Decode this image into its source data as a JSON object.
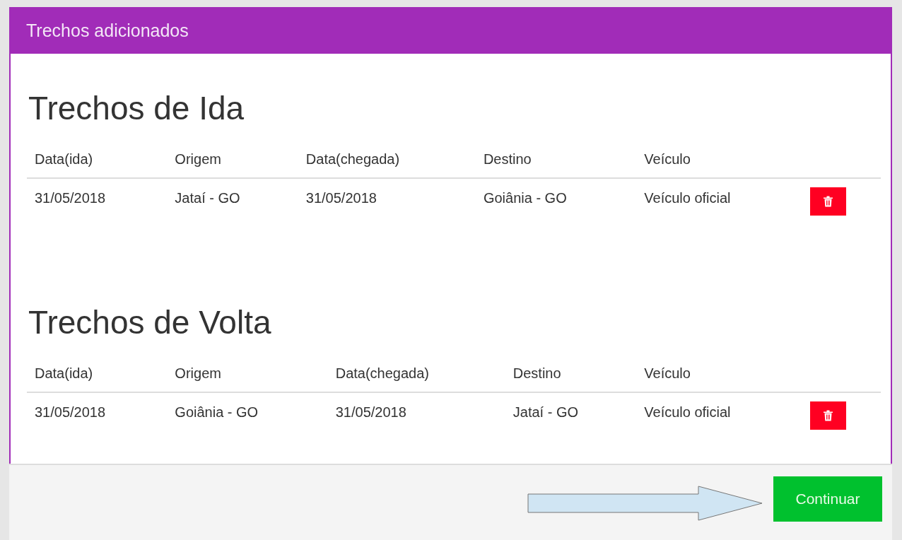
{
  "panel": {
    "title": "Trechos adicionados"
  },
  "sections": [
    {
      "heading": "Trechos de Ida",
      "columns": [
        "Data(ida)",
        "Origem",
        "Data(chegada)",
        "Destino",
        "Veículo"
      ],
      "rows": [
        {
          "cells": [
            "31/05/2018",
            "Jataí - GO",
            "31/05/2018",
            "Goiânia - GO",
            "Veículo oficial"
          ]
        }
      ]
    },
    {
      "heading": "Trechos de Volta",
      "columns": [
        "Data(ida)",
        "Origem",
        "Data(chegada)",
        "Destino",
        "Veículo"
      ],
      "rows": [
        {
          "cells": [
            "31/05/2018",
            "Goiânia - GO",
            "31/05/2018",
            "Jataí - GO",
            "Veículo oficial"
          ]
        }
      ]
    }
  ],
  "footer": {
    "button": "Continuar"
  }
}
